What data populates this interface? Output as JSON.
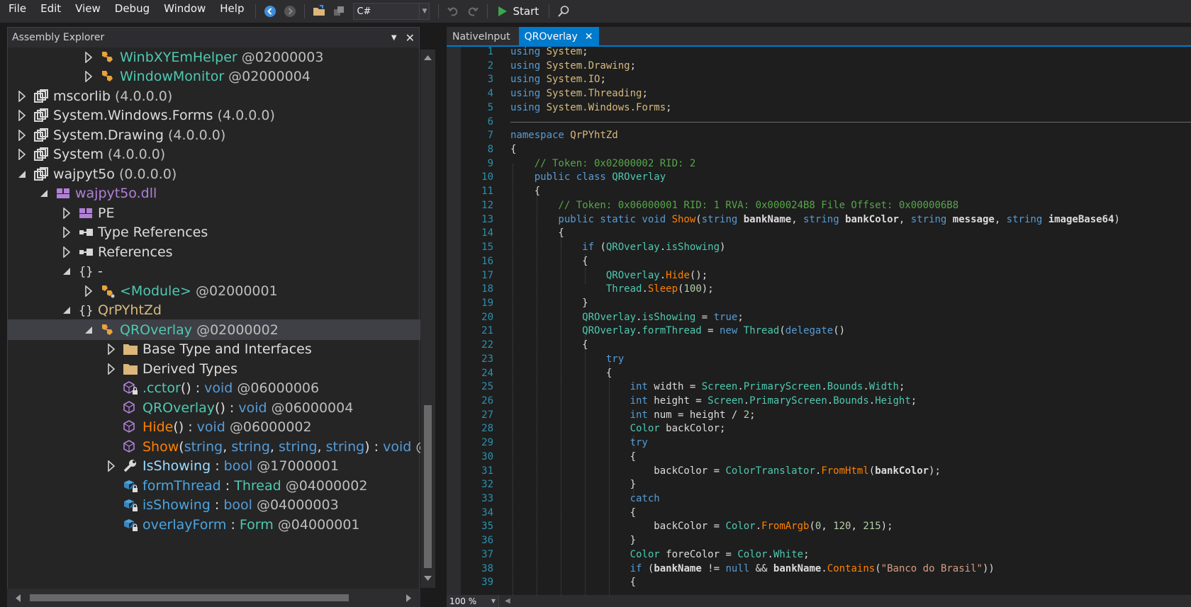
{
  "menu": [
    "File",
    "Edit",
    "View",
    "Debug",
    "Window",
    "Help"
  ],
  "toolbar": {
    "language": "C#",
    "start_label": "Start"
  },
  "explorer": {
    "title": "Assembly Explorer",
    "nodes": [
      {
        "parts": [
          {
            "t": "WinbXYEmHelper",
            "c": "t-type"
          },
          {
            "t": " @02000003",
            "c": "t-id"
          }
        ]
      },
      {
        "parts": [
          {
            "t": "WindowMonitor",
            "c": "t-type"
          },
          {
            "t": " @02000004",
            "c": "t-id"
          }
        ]
      },
      {
        "parts": [
          {
            "t": "mscorlib",
            "c": "t-asm"
          },
          {
            "t": " (4.0.0.0)",
            "c": "t-ver"
          }
        ]
      },
      {
        "parts": [
          {
            "t": "System.Windows.Forms",
            "c": "t-asm"
          },
          {
            "t": " (4.0.0.0)",
            "c": "t-ver"
          }
        ]
      },
      {
        "parts": [
          {
            "t": "System.Drawing",
            "c": "t-asm"
          },
          {
            "t": " (4.0.0.0)",
            "c": "t-ver"
          }
        ]
      },
      {
        "parts": [
          {
            "t": "System",
            "c": "t-asm"
          },
          {
            "t": " (4.0.0.0)",
            "c": "t-ver"
          }
        ]
      },
      {
        "parts": [
          {
            "t": "wajpyt5o",
            "c": "t-asm"
          },
          {
            "t": " (0.0.0.0)",
            "c": "t-ver"
          }
        ]
      },
      {
        "parts": [
          {
            "t": "wajpyt5o.dll",
            "c": "t-dll"
          }
        ]
      },
      {
        "parts": [
          {
            "t": "PE",
            "c": "t-plain"
          }
        ]
      },
      {
        "parts": [
          {
            "t": "Type References",
            "c": "t-plain"
          }
        ]
      },
      {
        "parts": [
          {
            "t": "References",
            "c": "t-plain"
          }
        ]
      },
      {
        "parts": [
          {
            "t": "-",
            "c": "t-plain"
          }
        ]
      },
      {
        "parts": [
          {
            "t": "<Module>",
            "c": "t-type"
          },
          {
            "t": " @02000001",
            "c": "t-id"
          }
        ]
      },
      {
        "parts": [
          {
            "t": "QrPYhtZd",
            "c": "t-ns"
          }
        ]
      },
      {
        "parts": [
          {
            "t": "QROverlay",
            "c": "t-type"
          },
          {
            "t": " @02000002",
            "c": "t-id"
          }
        ]
      },
      {
        "parts": [
          {
            "t": "Base Type and Interfaces",
            "c": "t-plain"
          }
        ]
      },
      {
        "parts": [
          {
            "t": "Derived Types",
            "c": "t-plain"
          }
        ]
      },
      {
        "parts": [
          {
            "t": ".cctor",
            "c": "t-meth"
          },
          {
            "t": "() : ",
            "c": "t-plain"
          },
          {
            "t": "void",
            "c": "t-kw"
          },
          {
            "t": " @06000006",
            "c": "t-id"
          }
        ]
      },
      {
        "parts": [
          {
            "t": "QROverlay",
            "c": "t-meth"
          },
          {
            "t": "() : ",
            "c": "t-plain"
          },
          {
            "t": "void",
            "c": "t-kw"
          },
          {
            "t": " @06000004",
            "c": "t-id"
          }
        ]
      },
      {
        "parts": [
          {
            "t": "Hide",
            "c": "t-meth2"
          },
          {
            "t": "() : ",
            "c": "t-plain"
          },
          {
            "t": "void",
            "c": "t-kw"
          },
          {
            "t": " @06000002",
            "c": "t-id"
          }
        ]
      },
      {
        "parts": [
          {
            "t": "Show",
            "c": "t-meth2"
          },
          {
            "t": "(",
            "c": "t-plain"
          },
          {
            "t": "string",
            "c": "t-kw"
          },
          {
            "t": ", ",
            "c": "t-plain"
          },
          {
            "t": "string",
            "c": "t-kw"
          },
          {
            "t": ", ",
            "c": "t-plain"
          },
          {
            "t": "string",
            "c": "t-kw"
          },
          {
            "t": ", ",
            "c": "t-plain"
          },
          {
            "t": "string",
            "c": "t-kw"
          },
          {
            "t": ") : ",
            "c": "t-plain"
          },
          {
            "t": "void",
            "c": "t-kw"
          },
          {
            "t": " @",
            "c": "t-id"
          }
        ]
      },
      {
        "parts": [
          {
            "t": "IsShowing",
            "c": "t-prop"
          },
          {
            "t": " : ",
            "c": "t-plain"
          },
          {
            "t": "bool",
            "c": "t-kw"
          },
          {
            "t": " @17000001",
            "c": "t-id"
          }
        ]
      },
      {
        "parts": [
          {
            "t": "formThread",
            "c": "t-field"
          },
          {
            "t": " : ",
            "c": "t-plain"
          },
          {
            "t": "Thread",
            "c": "t-type"
          },
          {
            "t": " @04000002",
            "c": "t-id"
          }
        ]
      },
      {
        "parts": [
          {
            "t": "isShowing",
            "c": "t-field"
          },
          {
            "t": " : ",
            "c": "t-plain"
          },
          {
            "t": "bool",
            "c": "t-kw"
          },
          {
            "t": " @04000003",
            "c": "t-id"
          }
        ]
      },
      {
        "parts": [
          {
            "t": "overlayForm",
            "c": "t-field"
          },
          {
            "t": " : ",
            "c": "t-plain"
          },
          {
            "t": "Form",
            "c": "t-type"
          },
          {
            "t": " @04000001",
            "c": "t-id"
          }
        ]
      }
    ]
  },
  "tabs": [
    {
      "label": "NativeInput",
      "active": false
    },
    {
      "label": "QROverlay",
      "active": true
    }
  ],
  "status": {
    "zoom": "100 %"
  },
  "code_lines": [
    {
      "n": "1",
      "parts": [
        {
          "t": "using ",
          "c": "c-kw"
        },
        {
          "t": "System",
          "c": "c-ns"
        },
        {
          "t": ";",
          "c": "c-plain"
        }
      ]
    },
    {
      "n": "2",
      "parts": [
        {
          "t": "using ",
          "c": "c-kw"
        },
        {
          "t": "System.Drawing",
          "c": "c-ns"
        },
        {
          "t": ";",
          "c": "c-plain"
        }
      ]
    },
    {
      "n": "3",
      "parts": [
        {
          "t": "using ",
          "c": "c-kw"
        },
        {
          "t": "System.IO",
          "c": "c-ns"
        },
        {
          "t": ";",
          "c": "c-plain"
        }
      ]
    },
    {
      "n": "4",
      "parts": [
        {
          "t": "using ",
          "c": "c-kw"
        },
        {
          "t": "System.Threading",
          "c": "c-ns"
        },
        {
          "t": ";",
          "c": "c-plain"
        }
      ]
    },
    {
      "n": "5",
      "parts": [
        {
          "t": "using ",
          "c": "c-kw"
        },
        {
          "t": "System.Windows.Forms",
          "c": "c-ns"
        },
        {
          "t": ";",
          "c": "c-plain"
        }
      ]
    },
    {
      "n": "6",
      "parts": []
    },
    {
      "n": "7",
      "parts": [
        {
          "t": "namespace ",
          "c": "c-kw"
        },
        {
          "t": "QrPYhtZd",
          "c": "c-ns"
        }
      ]
    },
    {
      "n": "8",
      "parts": [
        {
          "t": "{",
          "c": "c-plain"
        }
      ]
    },
    {
      "n": "9",
      "parts": [
        {
          "t": "    // Token: 0x02000002 RID: 2",
          "c": "c-com"
        }
      ]
    },
    {
      "n": "10",
      "parts": [
        {
          "t": "    public class ",
          "c": "c-kw"
        },
        {
          "t": "QROverlay",
          "c": "c-type"
        }
      ]
    },
    {
      "n": "11",
      "parts": [
        {
          "t": "    {",
          "c": "c-plain"
        }
      ]
    },
    {
      "n": "12",
      "parts": [
        {
          "t": "        // Token: 0x06000001 RID: 1 RVA: 0x000024B8 File Offset: 0x000006B8",
          "c": "c-com"
        }
      ]
    },
    {
      "n": "13",
      "parts": [
        {
          "t": "        public static void ",
          "c": "c-kw"
        },
        {
          "t": "Show",
          "c": "c-meth"
        },
        {
          "t": "(",
          "c": "c-plain"
        },
        {
          "t": "string ",
          "c": "c-kw"
        },
        {
          "t": "bankName",
          "c": "c-bold"
        },
        {
          "t": ", ",
          "c": "c-plain"
        },
        {
          "t": "string ",
          "c": "c-kw"
        },
        {
          "t": "bankColor",
          "c": "c-bold"
        },
        {
          "t": ", ",
          "c": "c-plain"
        },
        {
          "t": "string ",
          "c": "c-kw"
        },
        {
          "t": "message",
          "c": "c-bold"
        },
        {
          "t": ", ",
          "c": "c-plain"
        },
        {
          "t": "string ",
          "c": "c-kw"
        },
        {
          "t": "imageBase64",
          "c": "c-bold"
        },
        {
          "t": ")",
          "c": "c-plain"
        }
      ]
    },
    {
      "n": "14",
      "parts": [
        {
          "t": "        {",
          "c": "c-plain"
        }
      ]
    },
    {
      "n": "15",
      "parts": [
        {
          "t": "            if ",
          "c": "c-kw"
        },
        {
          "t": "(",
          "c": "c-plain"
        },
        {
          "t": "QROverlay",
          "c": "c-type"
        },
        {
          "t": ".",
          "c": "c-plain"
        },
        {
          "t": "isShowing",
          "c": "c-prop"
        },
        {
          "t": ")",
          "c": "c-plain"
        }
      ]
    },
    {
      "n": "16",
      "parts": [
        {
          "t": "            {",
          "c": "c-plain"
        }
      ]
    },
    {
      "n": "17",
      "parts": [
        {
          "t": "                ",
          "c": "c-plain"
        },
        {
          "t": "QROverlay",
          "c": "c-type"
        },
        {
          "t": ".",
          "c": "c-plain"
        },
        {
          "t": "Hide",
          "c": "c-meth"
        },
        {
          "t": "();",
          "c": "c-plain"
        }
      ]
    },
    {
      "n": "18",
      "parts": [
        {
          "t": "                ",
          "c": "c-plain"
        },
        {
          "t": "Thread",
          "c": "c-type"
        },
        {
          "t": ".",
          "c": "c-plain"
        },
        {
          "t": "Sleep",
          "c": "c-meth"
        },
        {
          "t": "(",
          "c": "c-plain"
        },
        {
          "t": "100",
          "c": "c-num"
        },
        {
          "t": ");",
          "c": "c-plain"
        }
      ]
    },
    {
      "n": "19",
      "parts": [
        {
          "t": "            }",
          "c": "c-plain"
        }
      ]
    },
    {
      "n": "20",
      "parts": [
        {
          "t": "            ",
          "c": "c-plain"
        },
        {
          "t": "QROverlay",
          "c": "c-type"
        },
        {
          "t": ".",
          "c": "c-plain"
        },
        {
          "t": "isShowing",
          "c": "c-prop"
        },
        {
          "t": " = ",
          "c": "c-plain"
        },
        {
          "t": "true",
          "c": "c-kw"
        },
        {
          "t": ";",
          "c": "c-plain"
        }
      ]
    },
    {
      "n": "21",
      "parts": [
        {
          "t": "            ",
          "c": "c-plain"
        },
        {
          "t": "QROverlay",
          "c": "c-type"
        },
        {
          "t": ".",
          "c": "c-plain"
        },
        {
          "t": "formThread",
          "c": "c-prop"
        },
        {
          "t": " = ",
          "c": "c-plain"
        },
        {
          "t": "new ",
          "c": "c-kw"
        },
        {
          "t": "Thread",
          "c": "c-type"
        },
        {
          "t": "(",
          "c": "c-plain"
        },
        {
          "t": "delegate",
          "c": "c-kw"
        },
        {
          "t": "()",
          "c": "c-plain"
        }
      ]
    },
    {
      "n": "22",
      "parts": [
        {
          "t": "            {",
          "c": "c-plain"
        }
      ]
    },
    {
      "n": "23",
      "parts": [
        {
          "t": "                try",
          "c": "c-kw"
        }
      ]
    },
    {
      "n": "24",
      "parts": [
        {
          "t": "                {",
          "c": "c-plain"
        }
      ]
    },
    {
      "n": "25",
      "parts": [
        {
          "t": "                    ",
          "c": "c-plain"
        },
        {
          "t": "int ",
          "c": "c-kw"
        },
        {
          "t": "width = ",
          "c": "c-plain"
        },
        {
          "t": "Screen",
          "c": "c-type"
        },
        {
          "t": ".",
          "c": "c-plain"
        },
        {
          "t": "PrimaryScreen",
          "c": "c-prop"
        },
        {
          "t": ".",
          "c": "c-plain"
        },
        {
          "t": "Bounds",
          "c": "c-prop"
        },
        {
          "t": ".",
          "c": "c-plain"
        },
        {
          "t": "Width",
          "c": "c-prop"
        },
        {
          "t": ";",
          "c": "c-plain"
        }
      ]
    },
    {
      "n": "26",
      "parts": [
        {
          "t": "                    ",
          "c": "c-plain"
        },
        {
          "t": "int ",
          "c": "c-kw"
        },
        {
          "t": "height = ",
          "c": "c-plain"
        },
        {
          "t": "Screen",
          "c": "c-type"
        },
        {
          "t": ".",
          "c": "c-plain"
        },
        {
          "t": "PrimaryScreen",
          "c": "c-prop"
        },
        {
          "t": ".",
          "c": "c-plain"
        },
        {
          "t": "Bounds",
          "c": "c-prop"
        },
        {
          "t": ".",
          "c": "c-plain"
        },
        {
          "t": "Height",
          "c": "c-prop"
        },
        {
          "t": ";",
          "c": "c-plain"
        }
      ]
    },
    {
      "n": "27",
      "parts": [
        {
          "t": "                    ",
          "c": "c-plain"
        },
        {
          "t": "int ",
          "c": "c-kw"
        },
        {
          "t": "num = height / ",
          "c": "c-plain"
        },
        {
          "t": "2",
          "c": "c-num"
        },
        {
          "t": ";",
          "c": "c-plain"
        }
      ]
    },
    {
      "n": "28",
      "parts": [
        {
          "t": "                    ",
          "c": "c-plain"
        },
        {
          "t": "Color ",
          "c": "c-type"
        },
        {
          "t": "backColor;",
          "c": "c-plain"
        }
      ]
    },
    {
      "n": "29",
      "parts": [
        {
          "t": "                    try",
          "c": "c-kw"
        }
      ]
    },
    {
      "n": "30",
      "parts": [
        {
          "t": "                    {",
          "c": "c-plain"
        }
      ]
    },
    {
      "n": "31",
      "parts": [
        {
          "t": "                        backColor = ",
          "c": "c-plain"
        },
        {
          "t": "ColorTranslator",
          "c": "c-type"
        },
        {
          "t": ".",
          "c": "c-plain"
        },
        {
          "t": "FromHtml",
          "c": "c-meth"
        },
        {
          "t": "(",
          "c": "c-plain"
        },
        {
          "t": "bankColor",
          "c": "c-bold"
        },
        {
          "t": ");",
          "c": "c-plain"
        }
      ]
    },
    {
      "n": "32",
      "parts": [
        {
          "t": "                    }",
          "c": "c-plain"
        }
      ]
    },
    {
      "n": "33",
      "parts": [
        {
          "t": "                    catch",
          "c": "c-kw"
        }
      ]
    },
    {
      "n": "34",
      "parts": [
        {
          "t": "                    {",
          "c": "c-plain"
        }
      ]
    },
    {
      "n": "35",
      "parts": [
        {
          "t": "                        backColor = ",
          "c": "c-plain"
        },
        {
          "t": "Color",
          "c": "c-type"
        },
        {
          "t": ".",
          "c": "c-plain"
        },
        {
          "t": "FromArgb",
          "c": "c-meth"
        },
        {
          "t": "(",
          "c": "c-plain"
        },
        {
          "t": "0",
          "c": "c-num"
        },
        {
          "t": ", ",
          "c": "c-plain"
        },
        {
          "t": "120",
          "c": "c-num"
        },
        {
          "t": ", ",
          "c": "c-plain"
        },
        {
          "t": "215",
          "c": "c-num"
        },
        {
          "t": ");",
          "c": "c-plain"
        }
      ]
    },
    {
      "n": "36",
      "parts": [
        {
          "t": "                    }",
          "c": "c-plain"
        }
      ]
    },
    {
      "n": "37",
      "parts": [
        {
          "t": "                    ",
          "c": "c-plain"
        },
        {
          "t": "Color ",
          "c": "c-type"
        },
        {
          "t": "foreColor = ",
          "c": "c-plain"
        },
        {
          "t": "Color",
          "c": "c-type"
        },
        {
          "t": ".",
          "c": "c-plain"
        },
        {
          "t": "White",
          "c": "c-prop"
        },
        {
          "t": ";",
          "c": "c-plain"
        }
      ]
    },
    {
      "n": "38",
      "parts": [
        {
          "t": "                    if ",
          "c": "c-kw"
        },
        {
          "t": "(",
          "c": "c-plain"
        },
        {
          "t": "bankName",
          "c": "c-bold"
        },
        {
          "t": " != ",
          "c": "c-plain"
        },
        {
          "t": "null",
          "c": "c-kw"
        },
        {
          "t": " && ",
          "c": "c-plain"
        },
        {
          "t": "bankName",
          "c": "c-bold"
        },
        {
          "t": ".",
          "c": "c-plain"
        },
        {
          "t": "Contains",
          "c": "c-meth"
        },
        {
          "t": "(",
          "c": "c-plain"
        },
        {
          "t": "\"Banco do Brasil\"",
          "c": "c-str"
        },
        {
          "t": "))",
          "c": "c-plain"
        }
      ]
    },
    {
      "n": "39",
      "parts": [
        {
          "t": "                    {",
          "c": "c-plain"
        }
      ]
    }
  ]
}
